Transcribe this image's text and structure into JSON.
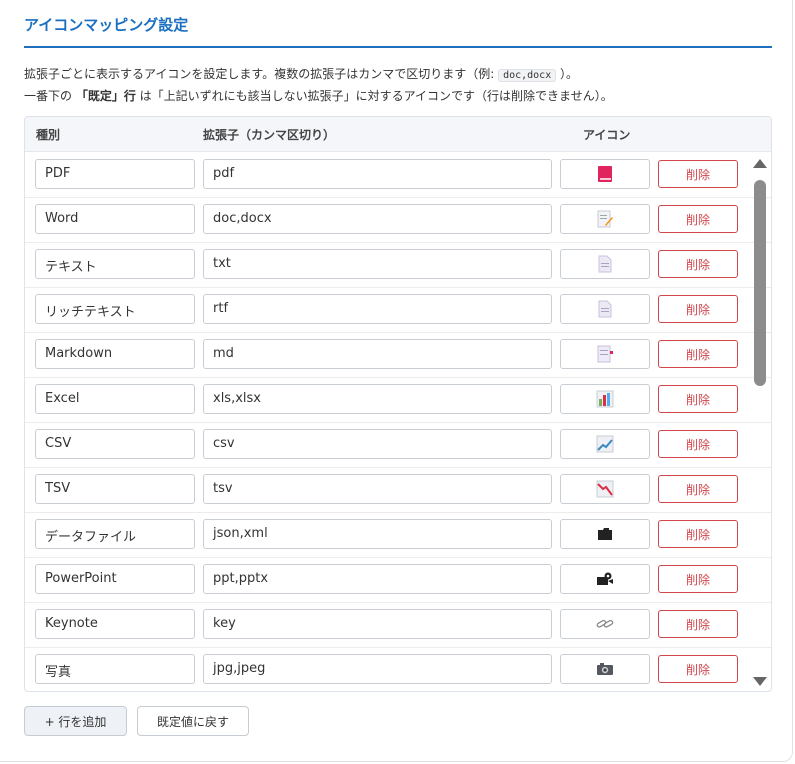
{
  "title": "アイコンマッピング設定",
  "description": {
    "line1_before": "拡張子ごとに表示するアイコンを設定します。複数の拡張子はカンマで区切ります（例: ",
    "line1_code": "doc,docx",
    "line1_after": " ）。",
    "line2_before": "一番下の ",
    "line2_bold": "「既定」行",
    "line2_after": " は「上記いずれにも該当しない拡張子」に対するアイコンです（行は削除できません）。"
  },
  "table": {
    "headers": {
      "kind": "種別",
      "ext": "拡張子（カンマ区切り）",
      "icon": "アイコン"
    },
    "delete_label": "削除",
    "rows": [
      {
        "kind": "PDF",
        "ext": "pdf",
        "icon": "book-icon"
      },
      {
        "kind": "Word",
        "ext": "doc,docx",
        "icon": "memo-icon"
      },
      {
        "kind": "テキスト",
        "ext": "txt",
        "icon": "page-icon"
      },
      {
        "kind": "リッチテキスト",
        "ext": "rtf",
        "icon": "page-icon"
      },
      {
        "kind": "Markdown",
        "ext": "md",
        "icon": "notebook-icon"
      },
      {
        "kind": "Excel",
        "ext": "xls,xlsx",
        "icon": "bar-chart-icon"
      },
      {
        "kind": "CSV",
        "ext": "csv",
        "icon": "chart-up-icon"
      },
      {
        "kind": "TSV",
        "ext": "tsv",
        "icon": "chart-down-icon"
      },
      {
        "kind": "データファイル",
        "ext": "json,xml",
        "icon": "folder-icon"
      },
      {
        "kind": "PowerPoint",
        "ext": "ppt,pptx",
        "icon": "projector-icon"
      },
      {
        "kind": "Keynote",
        "ext": "key",
        "icon": "link-icon"
      },
      {
        "kind": "写真",
        "ext": "jpg,jpeg",
        "icon": "camera-icon"
      }
    ]
  },
  "buttons": {
    "add_row": "+ 行を追加",
    "reset": "既定値に戻す"
  }
}
